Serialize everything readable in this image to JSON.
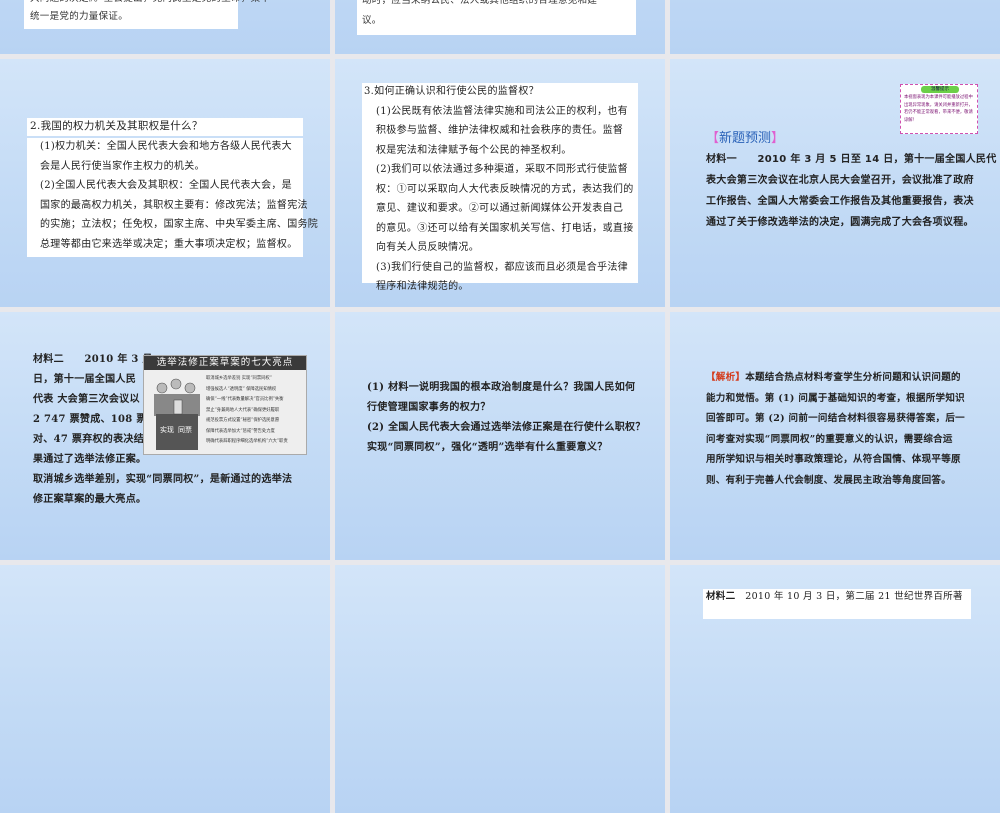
{
  "slides": {
    "s1": {
      "lines": [
        "大问题的决定》。全会提出，党内民主是党的生命，集中",
        "统一是党的力量保证。"
      ]
    },
    "s2": {
      "lines": [
        "动时，应当采纳公民、法人或其他组织的合理意见和建",
        "议。"
      ]
    },
    "s4": {
      "title": "2.我国的权力机关及其职权是什么？",
      "lines": [
        "(1)权力机关：全国人民代表大会和地方各级人民代表大",
        "会是人民行使当家作主权力的机关。",
        "(2)全国人民代表大会及其职权：全国人民代表大会，是",
        "国家的最高权力机关，其职权主要有：修改宪法；监督宪法",
        "的实施；立法权；任免权，国家主席、中央军委主席、国务院",
        "总理等都由它来选举或决定；重大事项决定权；监督权。"
      ]
    },
    "s5": {
      "title": "3.如何正确认识和行使公民的监督权？",
      "lines": [
        "(1)公民既有依法监督法律实施和司法公正的权利，也有",
        "积极参与监督、维护法律权威和社会秩序的责任。监督",
        "权是宪法和法律赋予每个公民的神圣权利。",
        "(2)我们可以依法通过多种渠道，采取不同形式行使监督",
        "权：①可以采取向人大代表反映情况的方式，表达我们的",
        "意见、建议和要求。②可以通过新闻媒体公开发表自己",
        "的意见。③还可以给有关国家机关写信、打电话，或直接",
        "向有关人员反映情况。",
        "(3)我们行使自己的监督权，都应该而且必须是合乎法律",
        "程序和法律规范的。"
      ]
    },
    "s6": {
      "tip_title": "温馨提示",
      "tip_text": "本视窗表现为本课件可能播放过程中出现异常现象，请关闭并重新打开，若仍不能正常观看，带来不便，敬请谅解！",
      "heading": "新题预测",
      "lines": [
        "材料一　　2010 年 3 月 5 日至 14 日，第十一届全国人民代",
        "表大会第三次会议在北京人民大会堂召开，会议批准了政府",
        "工作报告、全国人大常委会工作报告及其他重要报告，表决",
        "通过了关于修改选举法的决定，圆满完成了大会各项议程。"
      ]
    },
    "s7": {
      "lines": [
        "材料二　　2010 年 3 月",
        "日，第十一届全国人民",
        "代表  大会第三次会议以",
        "2 747 票赞成、108 票反",
        "对、47 票弃权的表决结",
        "果通过了选举法修正案。"
      ],
      "tail": [
        "取消城乡选举差别，实现“同票同权”，是新通过的选举法",
        "修正案草案的最大亮点。"
      ],
      "image_title": "选举法修正案草案的七大亮点",
      "image_items": [
        "取消城乡选举差别 实现“同票同权”",
        "增强候选人“透明度” 保障选民知情权",
        "确保“一线”代表数量解决“官员比例”失衡",
        "禁止“身兼两地人大代表”确保更好履职",
        "规范投票方式设置“秘密”保护选民意愿",
        "保障代表选举加大“惩戒”警告处力度",
        "明确代表辞职程序细化选举机构“六大”职责"
      ]
    },
    "s8": {
      "lines": [
        "(1) 材料一说明我国的根本政治制度是什么？我国人民如何",
        "行使管理国家事务的权力？",
        "(2) 全国人民代表大会通过选举法修正案是在行使什么职权？",
        "实现“同票同权”，强化“透明”选举有什么重要意义？"
      ]
    },
    "s9": {
      "tag": "【解析】",
      "lines": [
        "本题结合热点材料考查学生分析问题和认识问题的",
        "能力和觉悟。第 (1) 问属于基础知识的考查，根据所学知识",
        "回答即可。第 (2) 问前一问结合材料很容易获得答案，后一",
        "问考查对实现“同票同权”的重要意义的认识，需要综合运",
        "用所学知识与相关时事政策理论，从符合国情、体现平等原",
        "则、有利于完善人代会制度、发展民主政治等角度回答。"
      ]
    },
    "s12": {
      "label": "材料二",
      "text": "2010 年 10 月 3 日，第二届 21 世纪世界百所著"
    }
  }
}
